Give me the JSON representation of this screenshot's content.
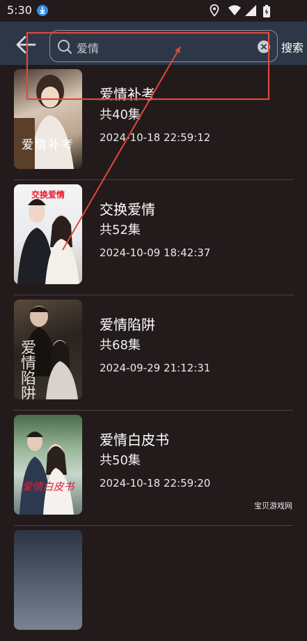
{
  "status_bar": {
    "time": "5:30"
  },
  "header": {
    "search_value": "爱情",
    "search_button_label": "搜索"
  },
  "results": [
    {
      "title": "爱情补考",
      "episodes": "共40集",
      "date": "2024-10-18 22:59:12",
      "cover_text": "爱情补考"
    },
    {
      "title": "交换爱情",
      "episodes": "共52集",
      "date": "2024-10-09 18:42:37",
      "cover_text": "交换爱情"
    },
    {
      "title": "爱情陷阱",
      "episodes": "共68集",
      "date": "2024-09-29 21:12:31",
      "cover_text": "爱情陷阱"
    },
    {
      "title": "爱情白皮书",
      "episodes": "共50集",
      "date": "2024-10-18 22:59:20",
      "cover_text": "爱情白皮书"
    }
  ],
  "watermark": "宝贝游戏网",
  "colors": {
    "background": "#231b1b",
    "header": "#2d3747",
    "annotation": "#e0483b"
  }
}
